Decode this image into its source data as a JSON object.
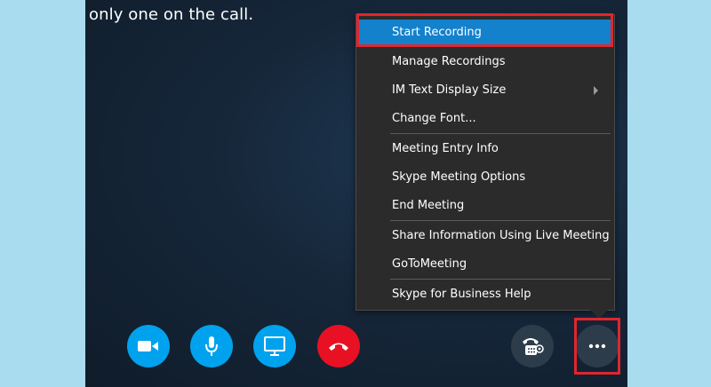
{
  "call": {
    "status_text": "only one on the call."
  },
  "menu": {
    "items": [
      {
        "label": "Start Recording"
      },
      {
        "label": "Manage Recordings"
      },
      {
        "label": "IM Text Display Size"
      },
      {
        "label": "Change Font..."
      },
      {
        "label": "Meeting Entry Info"
      },
      {
        "label": "Skype Meeting Options"
      },
      {
        "label": "End Meeting"
      },
      {
        "label": "Share Information Using Live Meeting"
      },
      {
        "label": "GoToMeeting"
      },
      {
        "label": "Skype for Business Help"
      }
    ]
  },
  "controls": {
    "icons": [
      "video-icon",
      "microphone-icon",
      "present-screen-icon",
      "hang-up-icon",
      "dial-pad-icon",
      "more-options-icon"
    ]
  },
  "colors": {
    "accent_blue": "#00a2ed",
    "hangup_red": "#e81123",
    "highlight_red": "#e0262d",
    "menu_selected": "#1381cc"
  }
}
